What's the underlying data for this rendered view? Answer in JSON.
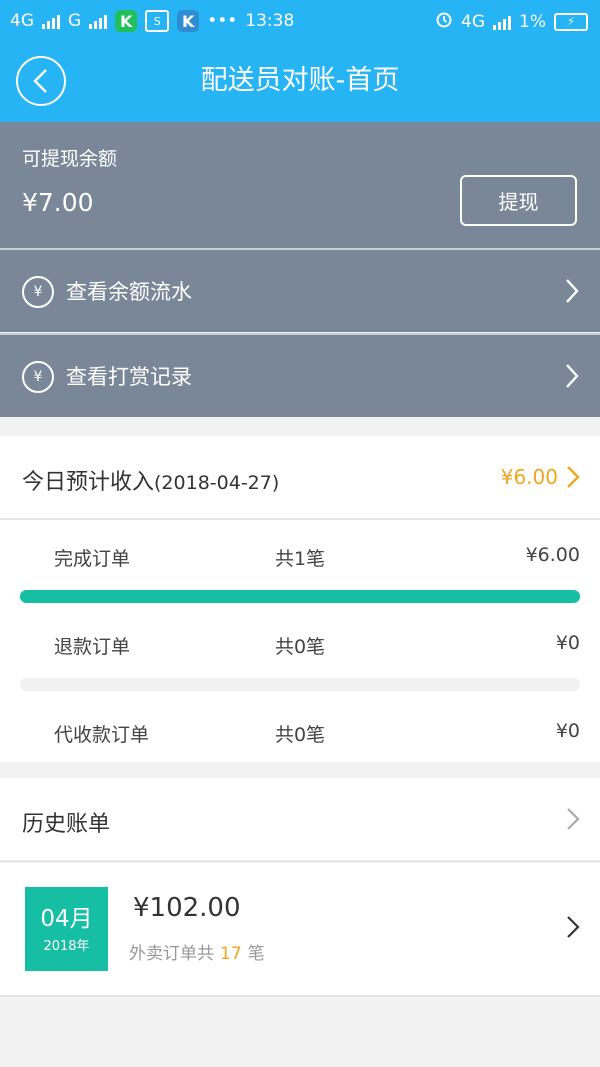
{
  "status_bar": {
    "net1": "4G",
    "net2": "G",
    "app_k": "K",
    "app_s": "S",
    "app_k2": "K",
    "dots": "•••",
    "time": "13:38",
    "net_right": "4G",
    "battery": "1%"
  },
  "header": {
    "title": "配送员对账-首页"
  },
  "balance": {
    "label": "可提现余额",
    "value": "¥7.00",
    "withdraw_label": "提现"
  },
  "menu": {
    "balance_flow": "查看余额流水",
    "tip_records": "查看打赏记录",
    "yen_glyph": "¥"
  },
  "today": {
    "title": "今日预计收入",
    "date": "(2018-04-27)",
    "amount": "¥6.00",
    "orders": [
      {
        "name": "完成订单",
        "count": "共1笔",
        "amount": "¥6.00",
        "progress": 1.0
      },
      {
        "name": "退款订单",
        "count": "共0笔",
        "amount": "¥0",
        "progress": 0.0
      },
      {
        "name": "代收款订单",
        "count": "共0笔",
        "amount": "¥0"
      }
    ]
  },
  "history": {
    "title": "历史账单",
    "items": [
      {
        "month": "04月",
        "year": "2018年",
        "amount": "¥102.00",
        "desc_prefix": "外卖订单共",
        "count": "17",
        "desc_suffix": "笔"
      }
    ]
  },
  "colors": {
    "accent": "#27b4f5",
    "card_gray": "#7a8799",
    "teal": "#16bfa4",
    "orange": "#efa521"
  }
}
